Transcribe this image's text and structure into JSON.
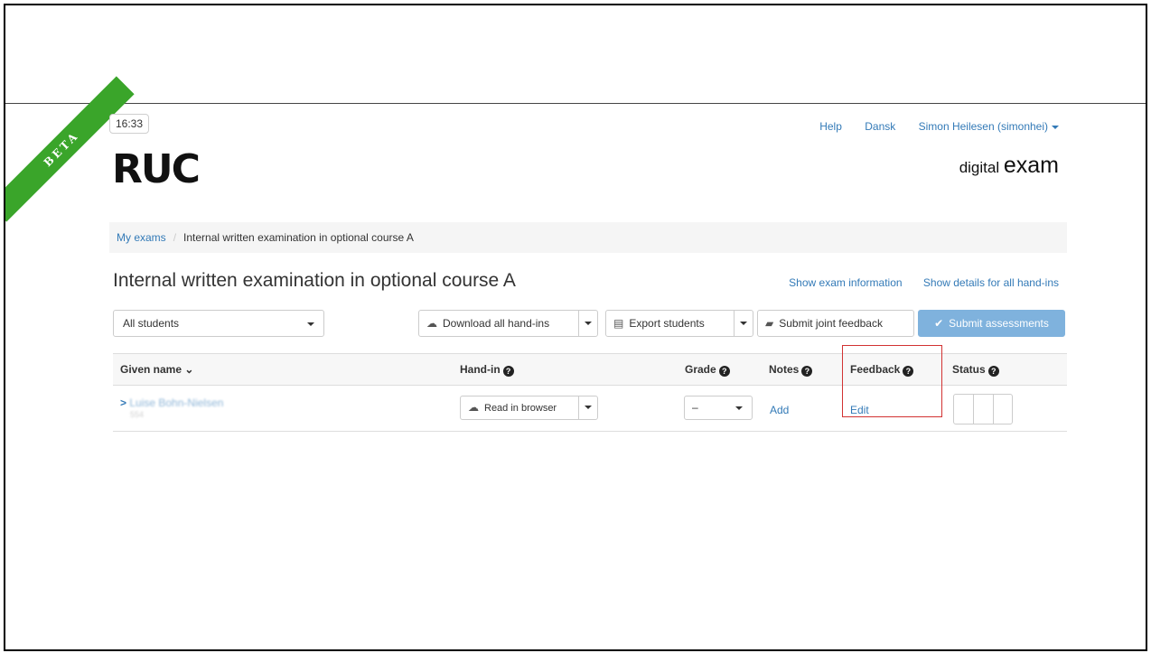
{
  "badge": {
    "ribbon": "BETA"
  },
  "header": {
    "clock": "16:33",
    "logo_text": "RUC",
    "nav": {
      "help": "Help",
      "language": "Dansk",
      "user": "Simon Heilesen (simonhei)"
    },
    "product": {
      "prefix": "digital",
      "main": "exam"
    }
  },
  "breadcrumb": {
    "root": "My exams",
    "current": "Internal written examination in optional course A"
  },
  "page": {
    "title": "Internal written examination in optional course A",
    "show_exam_info": "Show exam information",
    "show_all_details": "Show details for all hand-ins"
  },
  "toolbar": {
    "filter_value": "All students",
    "download": "Download all hand-ins",
    "export": "Export students",
    "joint_feedback": "Submit joint feedback",
    "submit": "Submit assessments"
  },
  "table": {
    "headers": {
      "given_name": "Given name",
      "handin": "Hand-in",
      "grade": "Grade",
      "notes": "Notes",
      "feedback": "Feedback",
      "status": "Status"
    },
    "rows": [
      {
        "name": "Luise Bohn-Nielsen",
        "id": "554",
        "handin": "Read in browser",
        "grade": "–",
        "notes": "Add",
        "feedback": "Edit"
      }
    ]
  },
  "colors": {
    "link": "#337ab7",
    "ribbon": "#3aa52a",
    "primary": "#7fb2dd",
    "highlight": "#d23232"
  }
}
